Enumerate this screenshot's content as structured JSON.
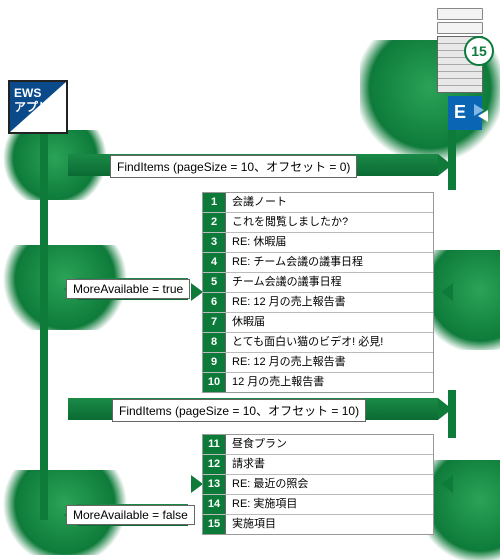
{
  "ews": {
    "line1": "EWS",
    "line2": "アプリ"
  },
  "server_badge": "15",
  "calls": {
    "first": "FindItems (pageSize = 10、オフセット = 0)",
    "second": "FindItems (pageSize = 10、オフセット = 10)",
    "more_true": "MoreAvailable = true",
    "more_false": "MoreAvailable = false"
  },
  "page1": [
    {
      "n": "1",
      "t": "会議ノート"
    },
    {
      "n": "2",
      "t": "これを閲覧しましたか?"
    },
    {
      "n": "3",
      "t": "RE: 休暇届"
    },
    {
      "n": "4",
      "t": "RE: チーム会議の議事日程"
    },
    {
      "n": "5",
      "t": "チーム会議の議事日程"
    },
    {
      "n": "6",
      "t": "RE: 12 月の売上報告書"
    },
    {
      "n": "7",
      "t": "休暇届"
    },
    {
      "n": "8",
      "t": "とても面白い猫のビデオ! 必見!"
    },
    {
      "n": "9",
      "t": "RE: 12 月の売上報告書"
    },
    {
      "n": "10",
      "t": "12 月の売上報告書"
    }
  ],
  "page2": [
    {
      "n": "11",
      "t": "昼食プラン"
    },
    {
      "n": "12",
      "t": "請求書"
    },
    {
      "n": "13",
      "t": "RE: 最近の照会"
    },
    {
      "n": "14",
      "t": "RE: 実施項目"
    },
    {
      "n": "15",
      "t": "実施項目"
    }
  ]
}
